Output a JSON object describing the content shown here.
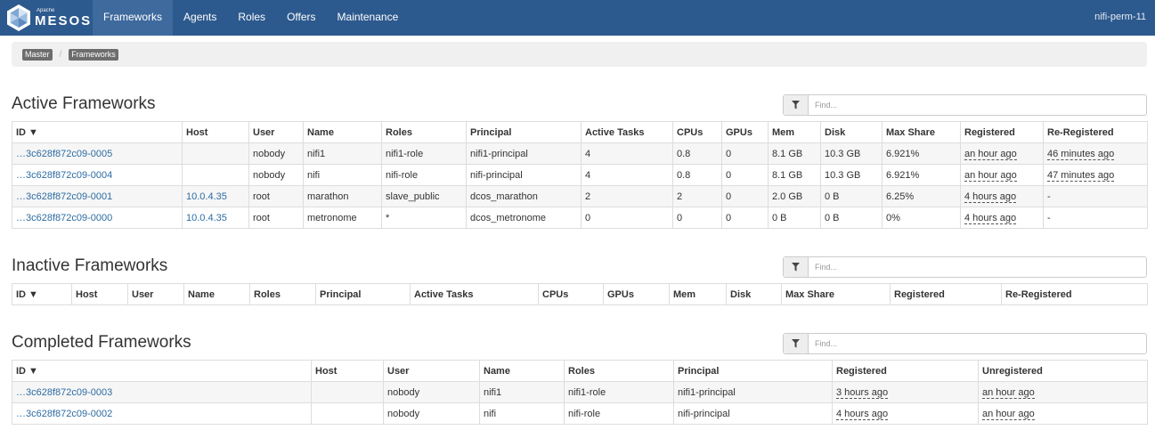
{
  "nav": {
    "brand_small": "Apache",
    "brand": "MESOS",
    "items": [
      {
        "label": "Frameworks"
      },
      {
        "label": "Agents"
      },
      {
        "label": "Roles"
      },
      {
        "label": "Offers"
      },
      {
        "label": "Maintenance"
      }
    ],
    "host": "nifi-perm-11"
  },
  "breadcrumb": [
    "Master",
    "Frameworks"
  ],
  "filter_placeholder": "Find...",
  "active": {
    "title": "Active Frameworks",
    "columns": [
      "ID ▼",
      "Host",
      "User",
      "Name",
      "Roles",
      "Principal",
      "Active Tasks",
      "CPUs",
      "GPUs",
      "Mem",
      "Disk",
      "Max Share",
      "Registered",
      "Re-Registered"
    ],
    "rows": [
      [
        "…3c628f872c09-0005",
        "",
        "nobody",
        "nifi1",
        "nifi1-role",
        "nifi1-principal",
        "4",
        "0.8",
        "0",
        "8.1 GB",
        "10.3 GB",
        "6.921%",
        "an hour ago",
        "46 minutes ago"
      ],
      [
        "…3c628f872c09-0004",
        "",
        "nobody",
        "nifi",
        "nifi-role",
        "nifi-principal",
        "4",
        "0.8",
        "0",
        "8.1 GB",
        "10.3 GB",
        "6.921%",
        "an hour ago",
        "47 minutes ago"
      ],
      [
        "…3c628f872c09-0001",
        "10.0.4.35",
        "root",
        "marathon",
        "slave_public",
        "dcos_marathon",
        "2",
        "2",
        "0",
        "2.0 GB",
        "0 B",
        "6.25%",
        "4 hours ago",
        "-"
      ],
      [
        "…3c628f872c09-0000",
        "10.0.4.35",
        "root",
        "metronome",
        "*",
        "dcos_metronome",
        "0",
        "0",
        "0",
        "0 B",
        "0 B",
        "0%",
        "4 hours ago",
        "-"
      ]
    ]
  },
  "inactive": {
    "title": "Inactive Frameworks",
    "columns": [
      "ID ▼",
      "Host",
      "User",
      "Name",
      "Roles",
      "Principal",
      "Active Tasks",
      "CPUs",
      "GPUs",
      "Mem",
      "Disk",
      "Max Share",
      "Registered",
      "Re-Registered"
    ]
  },
  "completed": {
    "title": "Completed Frameworks",
    "columns": [
      "ID ▼",
      "Host",
      "User",
      "Name",
      "Roles",
      "Principal",
      "Registered",
      "Unregistered"
    ],
    "rows": [
      [
        "…3c628f872c09-0003",
        "",
        "nobody",
        "nifi1",
        "nifi1-role",
        "nifi1-principal",
        "3 hours ago",
        "an hour ago"
      ],
      [
        "…3c628f872c09-0002",
        "",
        "nobody",
        "nifi",
        "nifi-role",
        "nifi-principal",
        "4 hours ago",
        "an hour ago"
      ]
    ]
  }
}
